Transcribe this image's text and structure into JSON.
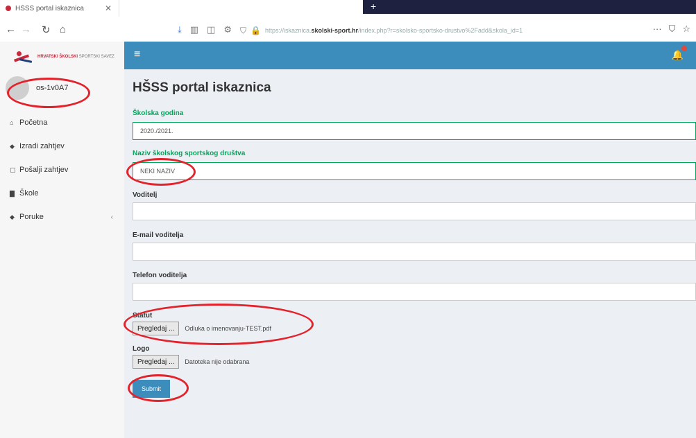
{
  "browser": {
    "tab_title": "HŠSS portal iskaznica",
    "tab_close": "✕",
    "new_tab": "+",
    "url_prefix": "https://iskaznica.",
    "url_domain": "skolski-sport.hr",
    "url_path": "/index.php?r=skolsko-sportsko-drustvo%2Fadd&skola_id=1",
    "more_icon": "···"
  },
  "sidebar": {
    "logo_brand": "HRVATSKI ŠKOLSKI",
    "logo_sub": "SPORTSKI SAVEZ",
    "user_name": "os-1v0A7",
    "items": [
      {
        "icon": "home-icon",
        "glyph": "⌂",
        "label": "Početna"
      },
      {
        "icon": "tag-icon",
        "glyph": "◆",
        "label": "Izradi zahtjev"
      },
      {
        "icon": "file-icon",
        "glyph": "▢",
        "label": "Pošalji zahtjev"
      },
      {
        "icon": "building-icon",
        "glyph": "▇",
        "label": "Škole"
      },
      {
        "icon": "tag-icon",
        "glyph": "◆",
        "label": "Poruke"
      }
    ]
  },
  "header": {
    "menu_glyph": "≡",
    "bell_glyph": "🔔"
  },
  "form": {
    "page_title": "HŠSS portal iskaznica",
    "school_year_label": "Školska godina",
    "school_year_value": "2020./2021.",
    "club_name_label": "Naziv školskog sportskog društva",
    "club_name_value": "NEKI NAZIV",
    "leader_label": "Voditelj",
    "leader_value": "",
    "leader_email_label": "E-mail voditelja",
    "leader_email_value": "",
    "leader_phone_label": "Telefon voditelja",
    "leader_phone_value": "",
    "statute_label": "Statut",
    "statute_button": "Pregledaj ...",
    "statute_file": "Odluka o imenovanju-TEST.pdf",
    "logo_label": "Logo",
    "logo_button": "Pregledaj ...",
    "logo_file": "Datoteka nije odabrana",
    "submit_label": "Submit"
  },
  "colors": {
    "header_blue": "#3c8dbc",
    "success_green": "#00a65a",
    "annotation_red": "#e3232c"
  }
}
